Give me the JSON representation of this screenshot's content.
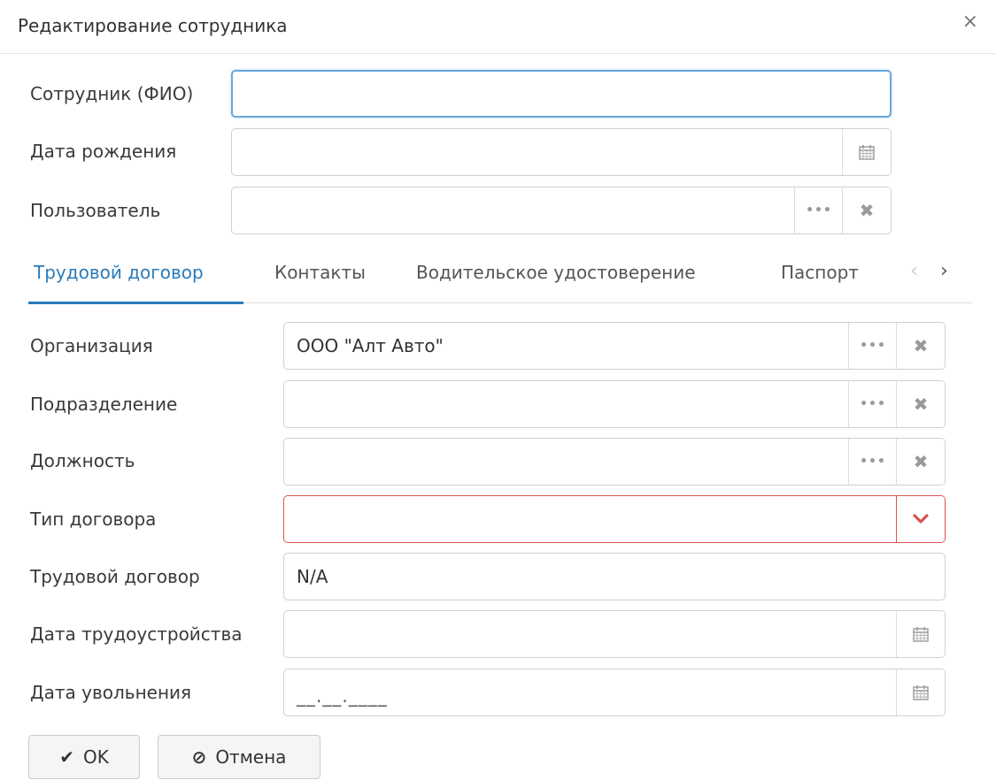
{
  "dialog": {
    "title": "Редактирование сотрудника",
    "close_label": "×"
  },
  "employee": {
    "fio_label": "Сотрудник (ФИО)",
    "fio_value": "",
    "birth_label": "Дата рождения",
    "birth_value": "",
    "user_label": "Пользователь",
    "user_value": ""
  },
  "tabs": {
    "items": [
      {
        "label": "Трудовой договор",
        "active": true
      },
      {
        "label": "Контакты",
        "active": false
      },
      {
        "label": "Водительское удостоверение",
        "active": false
      },
      {
        "label": "Паспорт",
        "active": false
      }
    ],
    "prev_glyph": "‹",
    "next_glyph": "›"
  },
  "contract": {
    "org_label": "Организация",
    "org_value": "ООО \"Алт Авто\"",
    "dept_label": "Подразделение",
    "dept_value": "",
    "position_label": "Должность",
    "position_value": "",
    "type_label": "Тип договора",
    "type_value": "",
    "contract_label": "Трудовой договор",
    "contract_value": "N/A",
    "hire_label": "Дата трудоустройства",
    "hire_value": "",
    "fire_label": "Дата увольнения",
    "fire_mask": "__.__.____"
  },
  "addons": {
    "dots": "•••",
    "clear": "✖"
  },
  "buttons": {
    "ok_icon": "✔",
    "ok_label": "OK",
    "cancel_icon": "⊘",
    "cancel_label": "Отмена"
  },
  "icons": {
    "calendar": "calendar-icon",
    "lookup": "ellipsis-icon",
    "clear": "clear-icon",
    "dropdown": "chevron-down-icon"
  },
  "colors": {
    "accent": "#2b7bb9",
    "error": "#d9534f",
    "focus": "#6aa6dc"
  }
}
